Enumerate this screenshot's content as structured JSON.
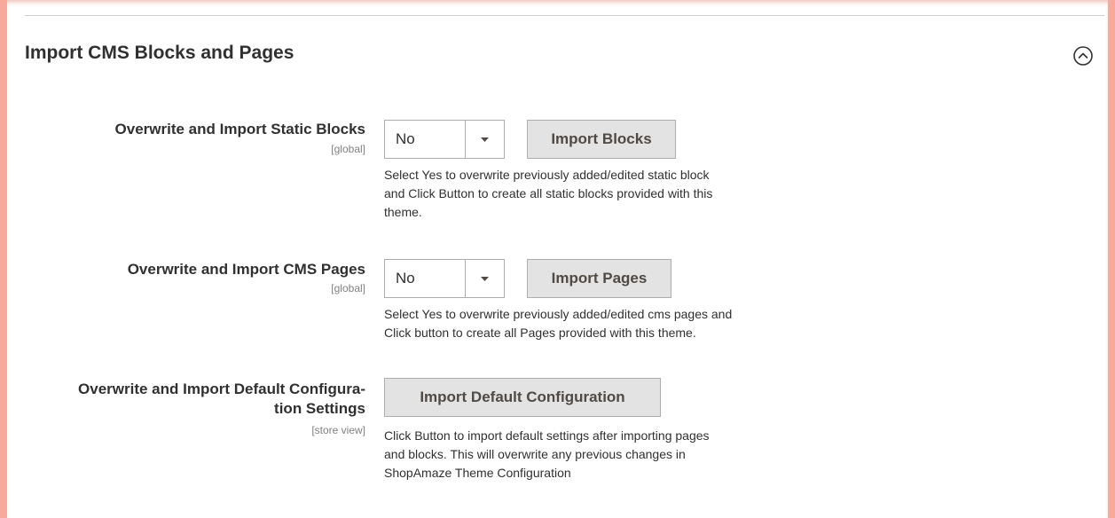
{
  "section": {
    "title": "Import CMS Blocks and Pages",
    "collapse_icon": "chevron-up-circle-icon"
  },
  "rows": [
    {
      "label": "Overwrite and Import Static Blocks",
      "scope": "[global]",
      "select_value": "No",
      "button_label": "Import Blocks",
      "note_lines": [
        "Select Yes to overwrite previously added/edited static block",
        "and Click Button to create all static blocks provided with this",
        "theme."
      ]
    },
    {
      "label": "Overwrite and Import CMS Pages",
      "scope": "[global]",
      "select_value": "No",
      "button_label": "Import Pages",
      "note_lines": [
        "Select Yes to overwrite previously added/edited cms pages and",
        "Click button to create all Pages provided with this theme."
      ]
    },
    {
      "label_lines": [
        "Overwrite and Import Default Configura-",
        "tion Settings"
      ],
      "scope": "[store view]",
      "button_label": "Import Default Configuration",
      "note_lines": [
        "Click Button to import default settings after importing pages",
        "and blocks. This will overwrite any previous changes in",
        "ShopAmaze Theme Configuration"
      ]
    }
  ],
  "colors": {
    "frame": "#f7a99c",
    "button_bg": "#e3e3e3",
    "border": "#adadad"
  }
}
